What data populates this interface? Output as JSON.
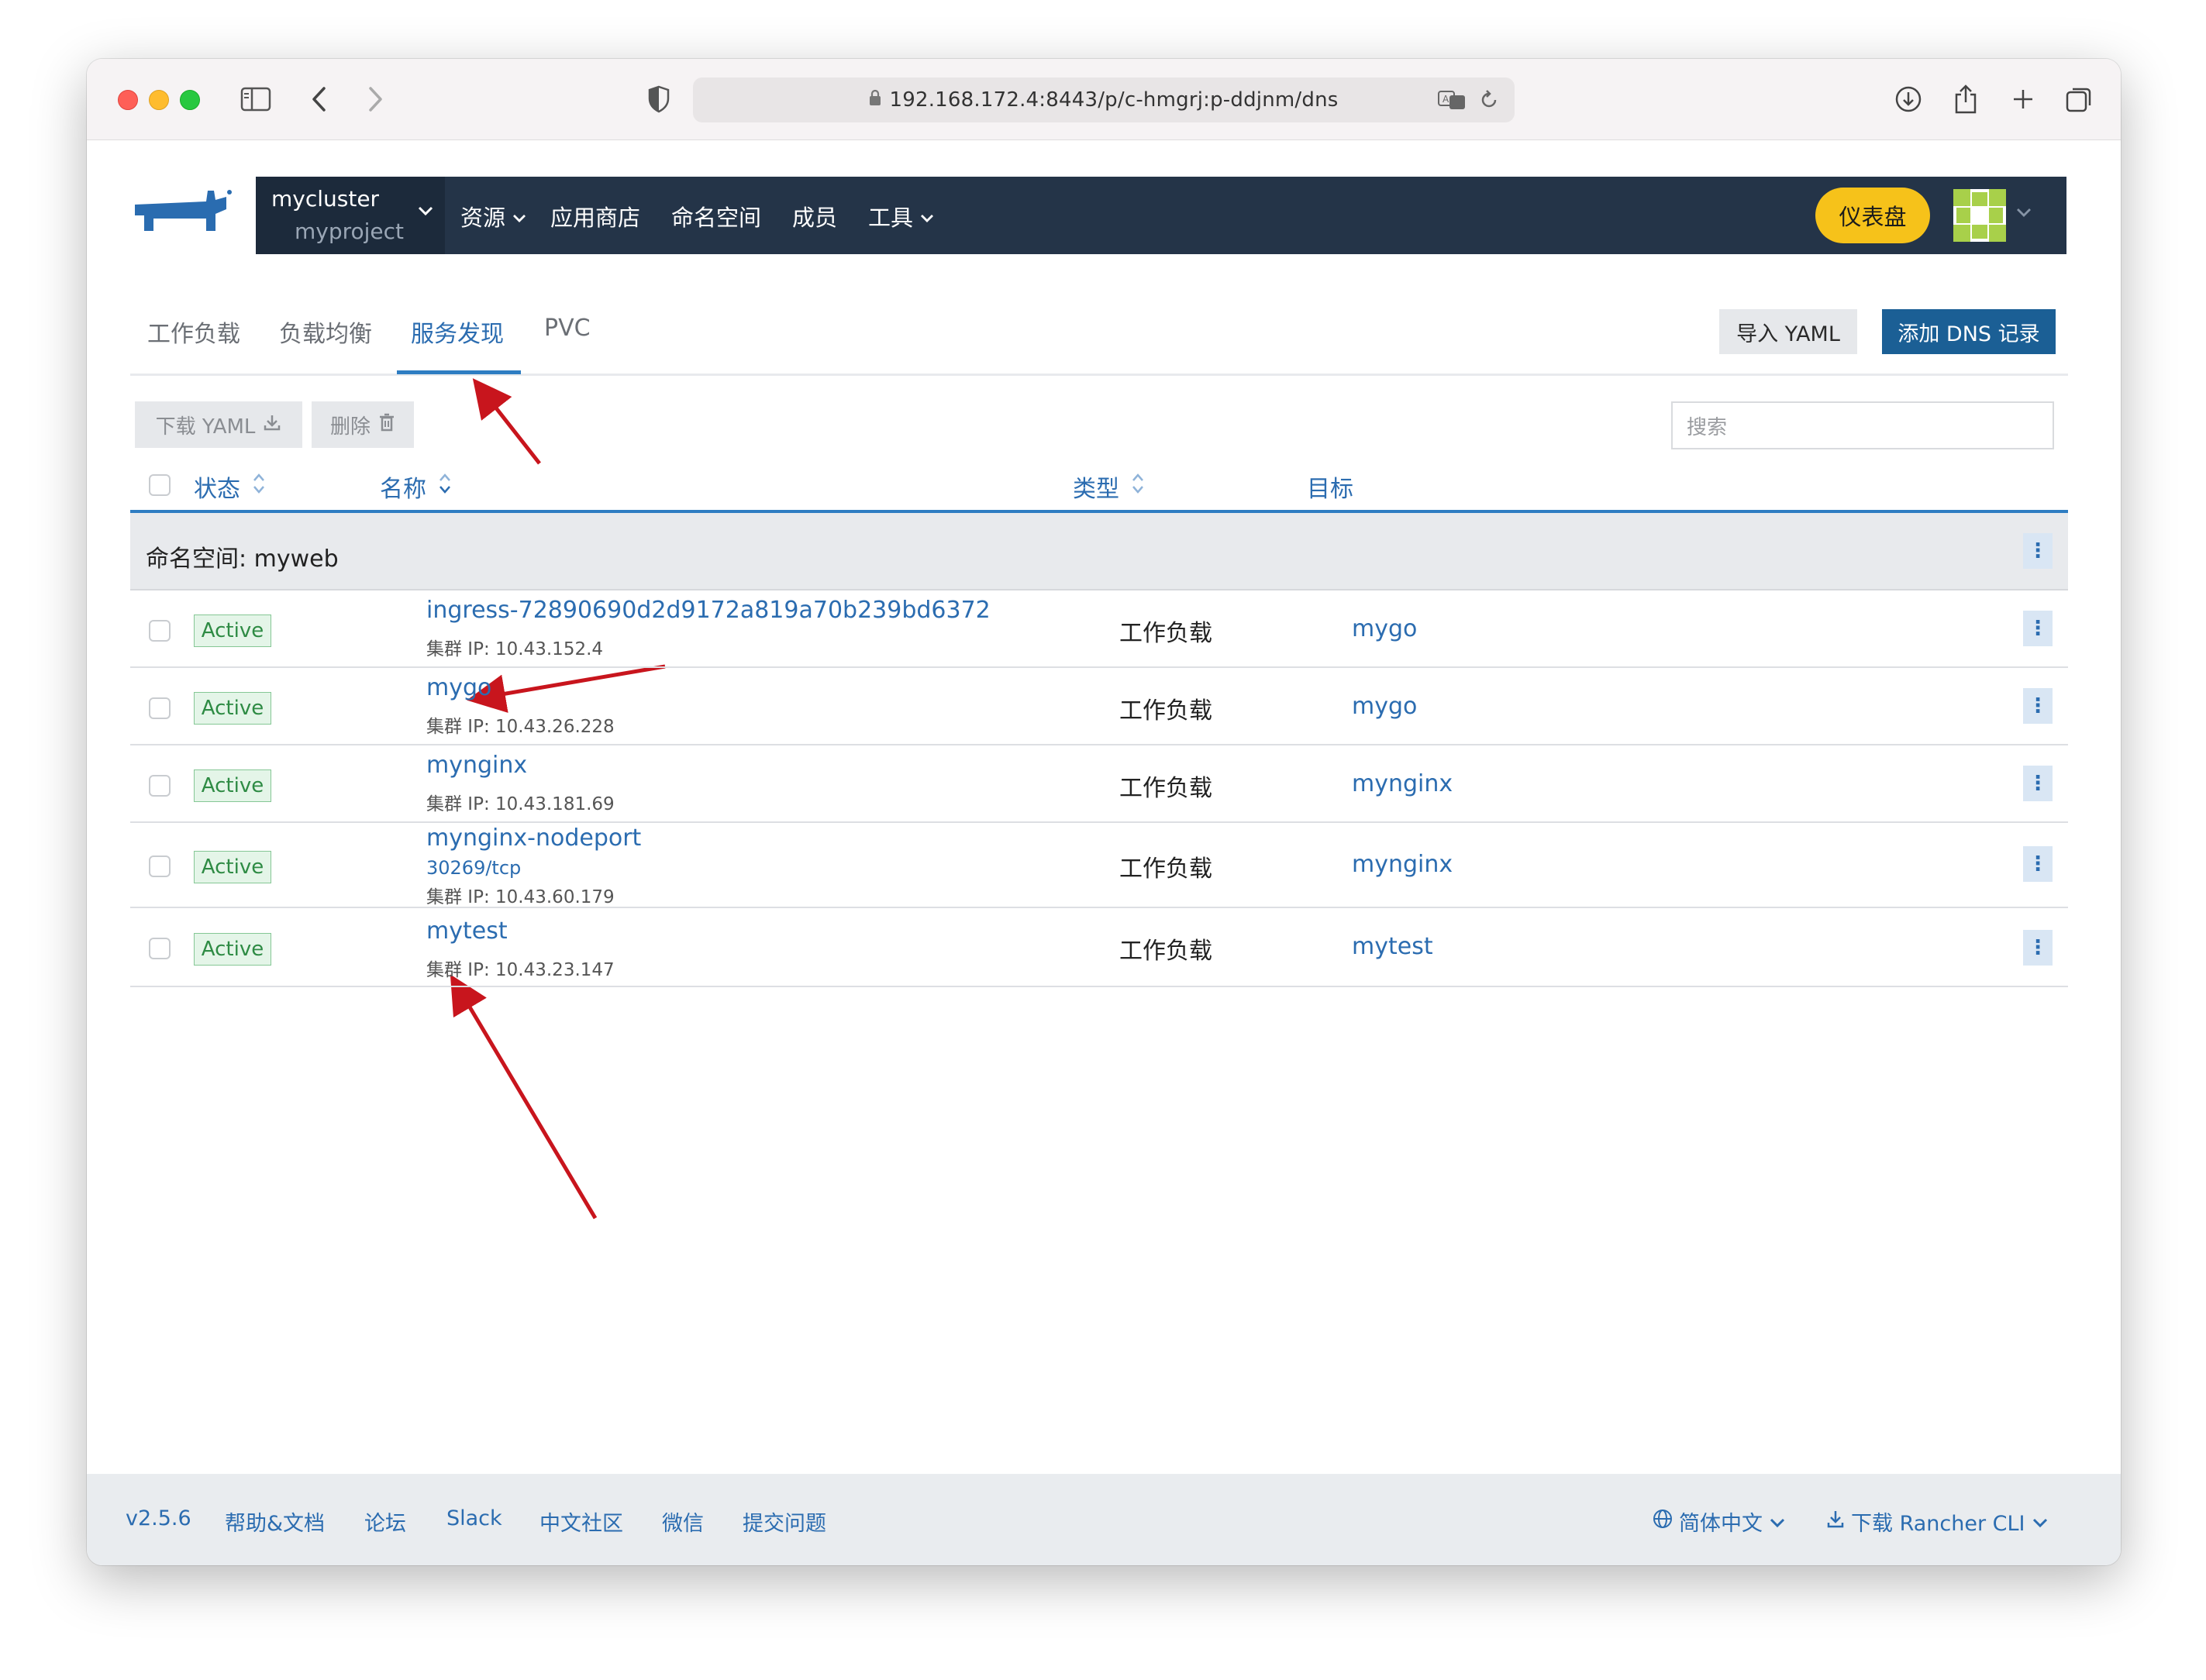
{
  "browser": {
    "url": "192.168.172.4:8443/p/c-hmgrj:p-ddjnm/dns"
  },
  "header": {
    "cluster": "mycluster",
    "project": "myproject",
    "nav": [
      {
        "label": "资源",
        "has_dropdown": true
      },
      {
        "label": "应用商店",
        "has_dropdown": false
      },
      {
        "label": "命名空间",
        "has_dropdown": false
      },
      {
        "label": "成员",
        "has_dropdown": false
      },
      {
        "label": "工具",
        "has_dropdown": true
      }
    ],
    "dashboard_button": "仪表盘",
    "colors": {
      "nav_bg": "#243448",
      "accent": "#f6c21a",
      "brand_blue": "#1b5f95"
    }
  },
  "tabs": [
    {
      "label": "工作负载",
      "active": false
    },
    {
      "label": "负载均衡",
      "active": false
    },
    {
      "label": "服务发现",
      "active": true
    },
    {
      "label": "PVC",
      "active": false
    }
  ],
  "actions": {
    "import_yaml": "导入 YAML",
    "add_dns": "添加 DNS 记录",
    "download_yaml": "下载 YAML",
    "delete": "删除",
    "search_placeholder": "搜索"
  },
  "table": {
    "columns": [
      "状态",
      "名称",
      "类型",
      "目标"
    ],
    "group_label": "命名空间: myweb",
    "rows": [
      {
        "status": "Active",
        "name": "ingress-72890690d2d9172a819a70b239bd6372",
        "port": "",
        "ip": "集群 IP: 10.43.152.4",
        "type": "工作负载",
        "target": "mygo"
      },
      {
        "status": "Active",
        "name": "mygo",
        "port": "",
        "ip": "集群 IP: 10.43.26.228",
        "type": "工作负载",
        "target": "mygo"
      },
      {
        "status": "Active",
        "name": "mynginx",
        "port": "",
        "ip": "集群 IP: 10.43.181.69",
        "type": "工作负载",
        "target": "mynginx"
      },
      {
        "status": "Active",
        "name": "mynginx-nodeport",
        "port": "30269/tcp",
        "ip": "集群 IP: 10.43.60.179",
        "type": "工作负载",
        "target": "mynginx"
      },
      {
        "status": "Active",
        "name": "mytest",
        "port": "",
        "ip": "集群 IP: 10.43.23.147",
        "type": "工作负载",
        "target": "mytest"
      }
    ]
  },
  "footer": {
    "version": "v2.5.6",
    "links": [
      "帮助&文档",
      "论坛",
      "Slack",
      "中文社区",
      "微信",
      "提交问题"
    ],
    "language": "简体中文",
    "cli": "下载 Rancher CLI"
  }
}
